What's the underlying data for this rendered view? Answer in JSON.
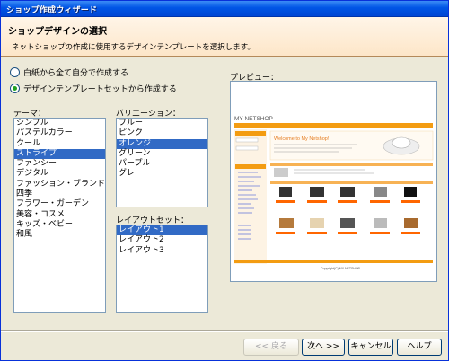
{
  "window": {
    "title": "ショップ作成ウィザード"
  },
  "header": {
    "title": "ショップデザインの選択",
    "subtitle": "ネットショップの作成に使用するデザインテンプレートを選択します。"
  },
  "options": [
    {
      "label": "白紙から全て自分で作成する",
      "selected": false
    },
    {
      "label": "デザインテンプレートセットから作成する",
      "selected": true
    }
  ],
  "theme": {
    "label": "テーマ：",
    "items": [
      "シンプル",
      "パステルカラー",
      "クール",
      "ストライプ",
      "ファンシー",
      "デジタル",
      "ファッション・ブランド",
      "四季",
      "フラワー・ガーデン",
      "美容・コスメ",
      "キッズ・ベビー",
      "和風"
    ],
    "selected_index": 3
  },
  "variation": {
    "label": "バリエーション：",
    "items": [
      "ブルー",
      "ピンク",
      "オレンジ",
      "グリーン",
      "パープル",
      "グレー"
    ],
    "selected_index": 2
  },
  "layout": {
    "label": "レイアウトセット：",
    "items": [
      "レイアウト1",
      "レイアウト2",
      "レイアウト3"
    ],
    "selected_index": 0
  },
  "preview": {
    "label": "プレビュー：",
    "shop_name": "MY NETSHOP",
    "welcome": "Welcome to My Netshop!",
    "footer": "Copyright(C) MY NETSHOP"
  },
  "buttons": {
    "back": "<< 戻る",
    "next": "次へ >>",
    "cancel": "キャンセル",
    "help": "ヘルプ"
  },
  "colors": {
    "accent": "#f39c12",
    "selection": "#316ac5",
    "title_bar": "#0055e5"
  }
}
